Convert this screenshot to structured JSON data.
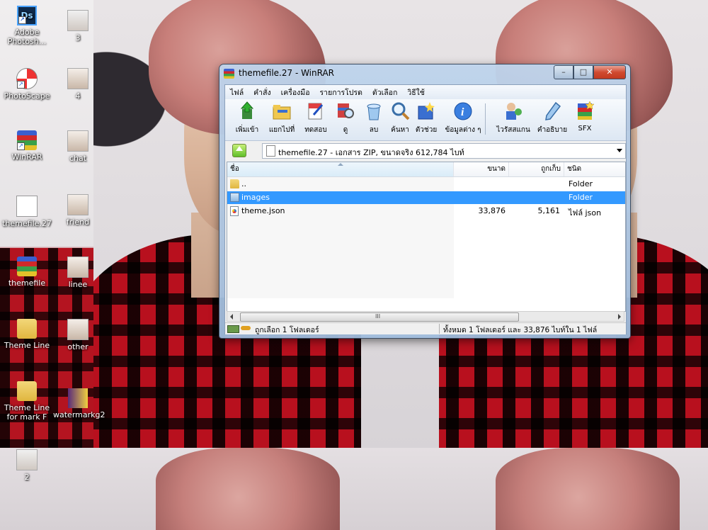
{
  "desktop": {
    "icons": [
      {
        "label": "Adobe Photosh...",
        "icon": "photoshop-icon"
      },
      {
        "label": "3",
        "icon": "image-file-icon"
      },
      {
        "label": "PhotoScape",
        "icon": "photoscape-icon"
      },
      {
        "label": "4",
        "icon": "image-file-icon"
      },
      {
        "label": "WinRAR",
        "icon": "winrar-icon"
      },
      {
        "label": "chat",
        "icon": "image-file-icon"
      },
      {
        "label": "themefile.27",
        "icon": "document-icon"
      },
      {
        "label": "friend",
        "icon": "image-file-icon"
      },
      {
        "label": "themefile",
        "icon": "winrar-archive-icon"
      },
      {
        "label": "linee",
        "icon": "image-file-icon"
      },
      {
        "label": "Theme Line",
        "icon": "folder-icon"
      },
      {
        "label": "other",
        "icon": "image-file-icon"
      },
      {
        "label": "Theme Line for mark F",
        "icon": "folder-icon"
      },
      {
        "label": "watermarkg2",
        "icon": "image-file-icon"
      },
      {
        "label": "2",
        "icon": "image-file-icon"
      }
    ]
  },
  "window": {
    "title": "themefile.27 - WinRAR",
    "controls": {
      "minimize": "–",
      "maximize": "□",
      "close": "✕"
    },
    "menu": [
      "ไฟล์",
      "คำสั่ง",
      "เครื่องมือ",
      "รายการโปรด",
      "ตัวเลือก",
      "วิธีใช้"
    ],
    "toolbar": [
      {
        "label": "เพิ่มเข้า",
        "icon": "add-icon"
      },
      {
        "label": "แยกไปที่",
        "icon": "extract-to-icon"
      },
      {
        "label": "ทดสอบ",
        "icon": "test-icon"
      },
      {
        "label": "ดู",
        "icon": "view-icon"
      },
      {
        "label": "ลบ",
        "icon": "delete-icon"
      },
      {
        "label": "ค้นหา",
        "icon": "find-icon"
      },
      {
        "label": "ตัวช่วย",
        "icon": "wizard-icon"
      },
      {
        "label": "ข้อมูลต่าง ๆ",
        "icon": "info-icon"
      },
      {
        "label": "ไวรัสสแกน",
        "icon": "virus-scan-icon"
      },
      {
        "label": "คำอธิบาย",
        "icon": "comment-icon"
      },
      {
        "label": "SFX",
        "icon": "sfx-icon"
      }
    ],
    "address": "themefile.27 - เอกสาร ZIP, ขนาดจริง 612,784 ไบท์",
    "columns": {
      "name": "ชื่อ",
      "size": "ขนาด",
      "packed": "ถูกเก็บ",
      "type": "ชนิด"
    },
    "files": [
      {
        "name": "..",
        "size": "",
        "packed": "",
        "type": "Folder",
        "icon": "parent-folder-icon",
        "selected": false
      },
      {
        "name": "images",
        "size": "",
        "packed": "",
        "type": "Folder",
        "icon": "folder-icon",
        "selected": true
      },
      {
        "name": "theme.json",
        "size": "33,876",
        "packed": "5,161",
        "type": "ไฟล์ json",
        "icon": "json-file-icon",
        "selected": false
      }
    ],
    "scroll_grip": "III",
    "status": {
      "left": "ถูกเลือก 1 โฟลเดอร์",
      "right": "ทั้งหมด 1 โฟลเดอร์ และ 33,876 ไบท์ใน 1 ไฟล์"
    }
  }
}
